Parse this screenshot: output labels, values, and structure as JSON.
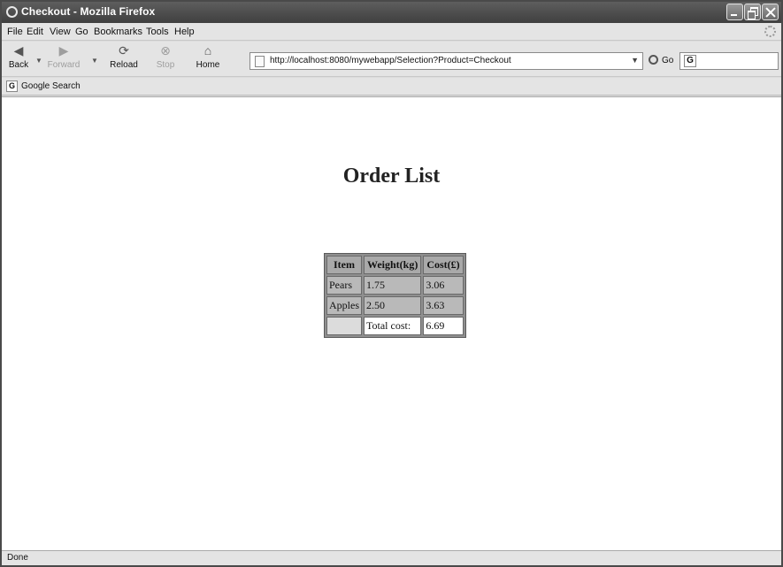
{
  "window": {
    "title": "Checkout - Mozilla Firefox"
  },
  "menu": [
    "File",
    "Edit",
    "View",
    "Go",
    "Bookmarks",
    "Tools",
    "Help"
  ],
  "toolbar": {
    "back": "Back",
    "forward": "Forward",
    "reload": "Reload",
    "stop": "Stop",
    "home": "Home",
    "go": "Go"
  },
  "address": {
    "url": "http://localhost:8080/mywebapp/Selection?Product=Checkout"
  },
  "search_toolbar": {
    "label": "Google Search"
  },
  "page": {
    "title": "Order List",
    "table": {
      "headers": [
        "Item",
        "Weight(kg)",
        "Cost(£)"
      ],
      "rows": [
        [
          "Pears",
          "1.75",
          "3.06"
        ],
        [
          "Apples",
          "2.50",
          "3.63"
        ]
      ],
      "total_label": "Total cost:",
      "total_value": "6.69"
    }
  },
  "status": {
    "text": "Done"
  }
}
